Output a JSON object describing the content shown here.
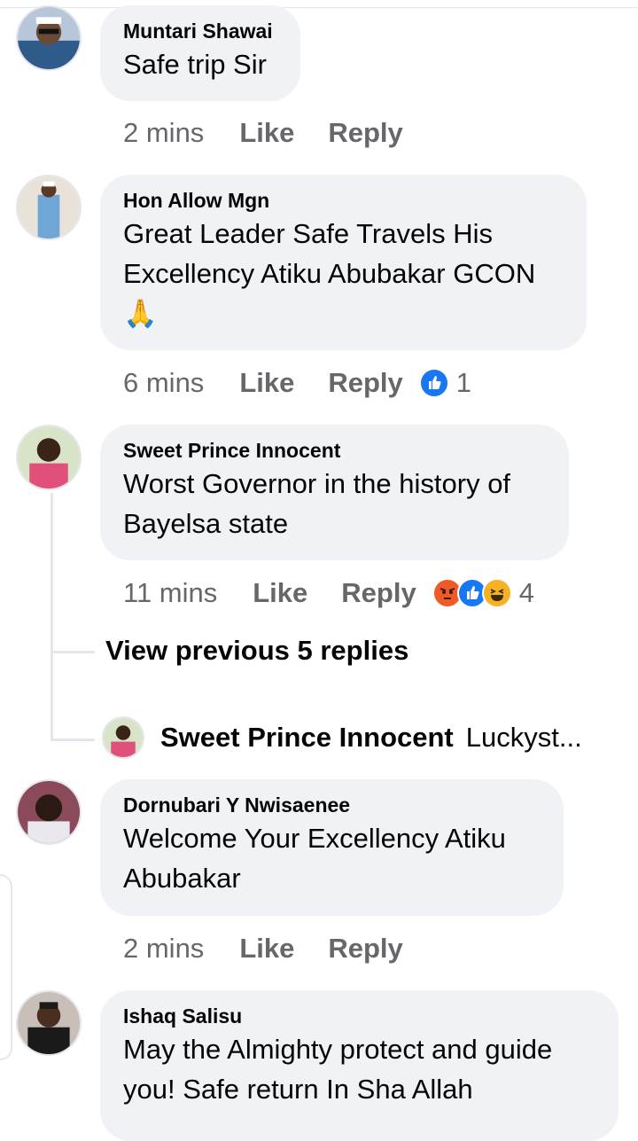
{
  "comments": [
    {
      "author": "Muntari Shawai",
      "lines": [
        "Safe trip Sir"
      ],
      "time": "2 mins",
      "like": "Like",
      "reply": "Reply"
    },
    {
      "author": "Hon Allow Mgn",
      "lines": [
        "Great Leader Safe Travels His",
        "Excellency Atiku Abubakar GCON",
        "🙏"
      ],
      "time": "6 mins",
      "like": "Like",
      "reply": "Reply",
      "reactions": [
        "like-icon"
      ],
      "reaction_count": "1"
    },
    {
      "author": "Sweet Prince Innocent",
      "lines": [
        "Worst Governor in the history of",
        "Bayelsa state"
      ],
      "time": "11 mins",
      "like": "Like",
      "reply": "Reply",
      "reactions": [
        "angry-icon",
        "like-icon",
        "haha-icon"
      ],
      "reaction_count": "4"
    },
    {
      "author": "Dornubari Y Nwisaenee",
      "lines": [
        "Welcome Your Excellency Atiku",
        "Abubakar"
      ],
      "time": "2 mins",
      "like": "Like",
      "reply": "Reply"
    },
    {
      "author": "Ishaq Salisu",
      "lines": [
        "May the Almighty protect and guide",
        "you! Safe return In Sha Allah"
      ]
    }
  ],
  "thread": {
    "view_previous": "View previous 5 replies",
    "reply_author": "Sweet Prince Innocent",
    "reply_preview": "Luckyst..."
  },
  "colors": {
    "bubble": "#f0f2f5",
    "meta_text": "#65676b",
    "like_blue": "#1877f2",
    "angry": "#f05a28",
    "haha": "#f7b125"
  }
}
